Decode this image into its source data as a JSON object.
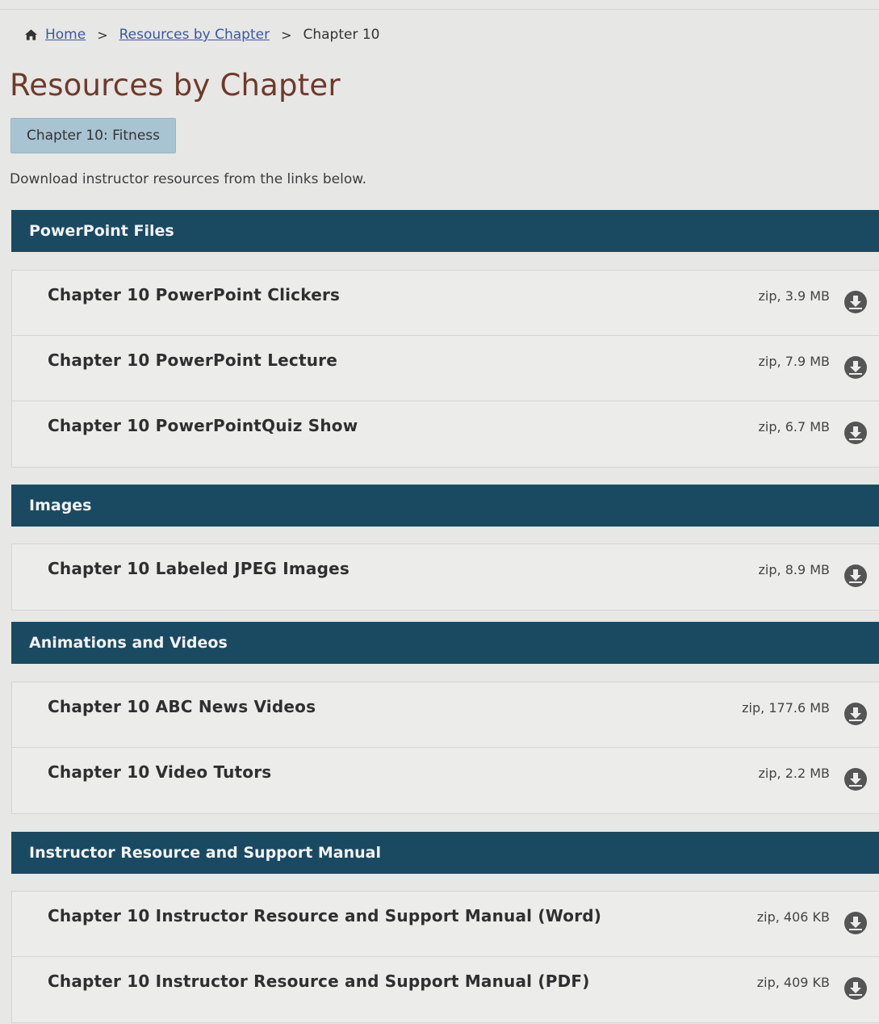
{
  "breadcrumb": {
    "home": "Home",
    "resources": "Resources by Chapter",
    "current": "Chapter 10",
    "separator": ">"
  },
  "page_title": "Resources by Chapter",
  "chapter_button": "Chapter 10: Fitness",
  "intro": "Download instructor resources from the links below.",
  "sections": [
    {
      "title": "PowerPoint Files",
      "items": [
        {
          "title": "Chapter 10 PowerPoint Clickers",
          "meta": "zip, 3.9 MB"
        },
        {
          "title": "Chapter 10 PowerPoint Lecture",
          "meta": "zip, 7.9 MB"
        },
        {
          "title": "Chapter 10 PowerPointQuiz Show",
          "meta": "zip, 6.7 MB"
        }
      ]
    },
    {
      "title": "Images",
      "items": [
        {
          "title": "Chapter 10 Labeled JPEG Images",
          "meta": "zip, 8.9 MB"
        }
      ]
    },
    {
      "title": "Animations and Videos",
      "items": [
        {
          "title": "Chapter 10 ABC News Videos",
          "meta": "zip, 177.6 MB"
        },
        {
          "title": "Chapter 10 Video Tutors",
          "meta": "zip, 2.2 MB"
        }
      ]
    },
    {
      "title": "Instructor Resource and Support Manual",
      "items": [
        {
          "title": "Chapter 10 Instructor Resource and Support Manual (Word)",
          "meta": "zip, 406 KB"
        },
        {
          "title": "Chapter 10 Instructor Resource and Support Manual (PDF)",
          "meta": "zip, 409 KB"
        }
      ]
    }
  ],
  "colors": {
    "section_header": "#1a4a62",
    "title": "#6e3a2a",
    "link": "#3b56a3",
    "chapter_button": "#a8c3d2"
  },
  "icons": {
    "home": "home-icon",
    "download": "download-icon"
  }
}
